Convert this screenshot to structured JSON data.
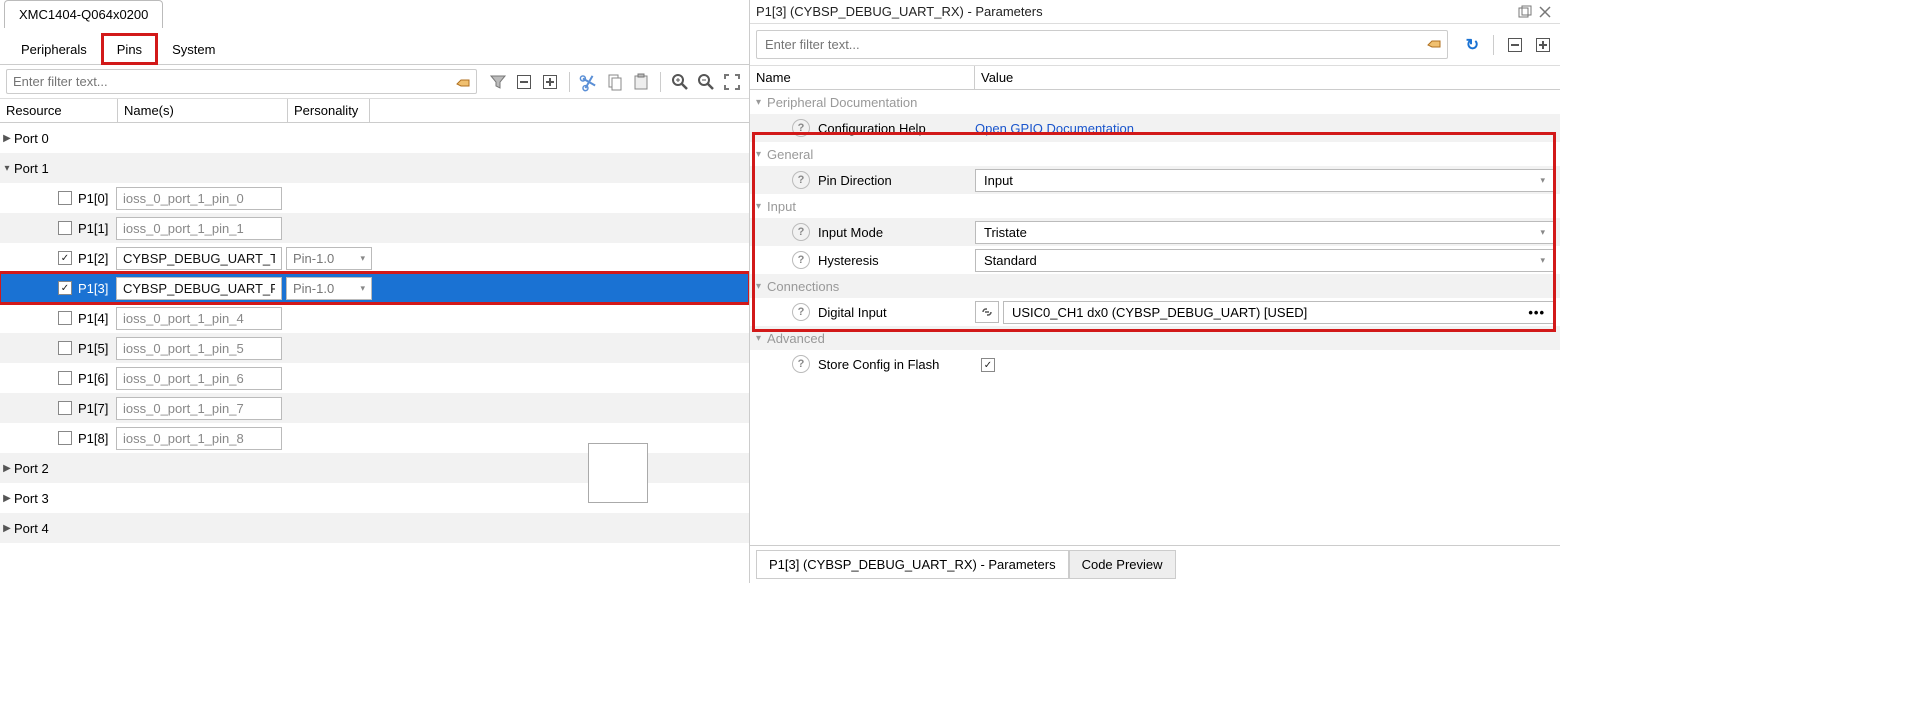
{
  "device_tab": "XMC1404-Q064x0200",
  "section_tabs": {
    "peripherals": "Peripherals",
    "pins": "Pins",
    "system": "System"
  },
  "left_filter_placeholder": "Enter filter text...",
  "tree_headers": {
    "resource": "Resource",
    "names": "Name(s)",
    "personality": "Personality"
  },
  "ports": {
    "port0": "Port 0",
    "port1": "Port 1",
    "port2": "Port 2",
    "port3": "Port 3",
    "port4": "Port 4"
  },
  "pins": [
    {
      "label": "P1[0]",
      "checked": false,
      "name": "ioss_0_port_1_pin_0",
      "pers": ""
    },
    {
      "label": "P1[1]",
      "checked": false,
      "name": "ioss_0_port_1_pin_1",
      "pers": ""
    },
    {
      "label": "P1[2]",
      "checked": true,
      "name": "CYBSP_DEBUG_UART_TX",
      "pers": "Pin-1.0"
    },
    {
      "label": "P1[3]",
      "checked": true,
      "name": "CYBSP_DEBUG_UART_RX",
      "pers": "Pin-1.0"
    },
    {
      "label": "P1[4]",
      "checked": false,
      "name": "ioss_0_port_1_pin_4",
      "pers": ""
    },
    {
      "label": "P1[5]",
      "checked": false,
      "name": "ioss_0_port_1_pin_5",
      "pers": ""
    },
    {
      "label": "P1[6]",
      "checked": false,
      "name": "ioss_0_port_1_pin_6",
      "pers": ""
    },
    {
      "label": "P1[7]",
      "checked": false,
      "name": "ioss_0_port_1_pin_7",
      "pers": ""
    },
    {
      "label": "P1[8]",
      "checked": false,
      "name": "ioss_0_port_1_pin_8",
      "pers": ""
    }
  ],
  "right_title": "P1[3] (CYBSP_DEBUG_UART_RX) - Parameters",
  "right_filter_placeholder": "Enter filter text...",
  "param_headers": {
    "name": "Name",
    "value": "Value"
  },
  "groups": {
    "doc": "Peripheral Documentation",
    "general": "General",
    "input": "Input",
    "connections": "Connections",
    "advanced": "Advanced"
  },
  "params": {
    "config_help_label": "Configuration Help",
    "config_help_link": "Open GPIO Documentation",
    "pin_dir_label": "Pin Direction",
    "pin_dir_value": "Input",
    "input_mode_label": "Input Mode",
    "input_mode_value": "Tristate",
    "hysteresis_label": "Hysteresis",
    "hysteresis_value": "Standard",
    "digital_input_label": "Digital Input",
    "digital_input_value": "USIC0_CH1 dx0 (CYBSP_DEBUG_UART) [USED]",
    "store_cfg_label": "Store Config in Flash"
  },
  "bottom_tabs": {
    "params": "P1[3] (CYBSP_DEBUG_UART_RX) - Parameters",
    "code": "Code Preview"
  },
  "glyphs": {
    "check": "✓",
    "caret_down": "▾",
    "caret_right": "▶",
    "more": "•••"
  }
}
